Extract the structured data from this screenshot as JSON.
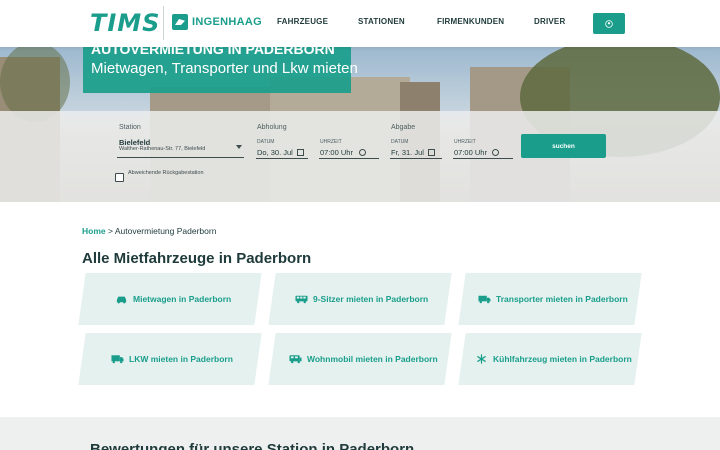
{
  "header": {
    "logo_primary": "TIMS",
    "logo_secondary": "INGENHAAG",
    "nav": [
      "FAHRZEUGE",
      "STATIONEN",
      "FIRMENKUNDEN",
      "DRIVER"
    ],
    "user_icon": "user-circle-icon"
  },
  "hero": {
    "title": "AUTOVERMIETUNG IN PADERBORN",
    "subtitle": "Mietwagen, Transporter und Lkw mieten"
  },
  "search": {
    "station_label": "Station",
    "station_name": "Bielefeld",
    "station_address": "Walther-Rathenau-Str. 77, Bielefeld",
    "pickup_label": "Abholung",
    "return_label": "Abgabe",
    "date_label": "DATUM",
    "time_label": "UHRZEIT",
    "pickup_date": "Do, 30. Jul",
    "pickup_time": "07:00 Uhr",
    "return_date": "Fr, 31. Jul",
    "return_time": "07:00 Uhr",
    "submit_label": "suchen",
    "different_return_label": "Abweichende Rückgabestation",
    "different_return_checked": false
  },
  "breadcrumb": {
    "home": "Home",
    "separator": " > ",
    "current": "Autovermietung Paderborn"
  },
  "section_title": "Alle Mietfahrzeuge in Paderborn",
  "cards": [
    {
      "label": "Mietwagen in Paderborn",
      "icon": "car-icon"
    },
    {
      "label": "9-Sitzer mieten in Paderborn",
      "icon": "bus-icon"
    },
    {
      "label": "Transporter mieten in Paderborn",
      "icon": "van-icon"
    },
    {
      "label": "LKW mieten in Paderborn",
      "icon": "truck-icon"
    },
    {
      "label": "Wohnmobil mieten in Paderborn",
      "icon": "camper-icon"
    },
    {
      "label": "Kühlfahrzeug mieten in Paderborn",
      "icon": "snowflake-icon"
    }
  ],
  "reviews_title": "Bewertungen für unsere Station in Paderborn",
  "colors": {
    "brand": "#1a9e8b",
    "card_bg": "#e4f1ef",
    "text_dark": "#1f3a3a"
  }
}
